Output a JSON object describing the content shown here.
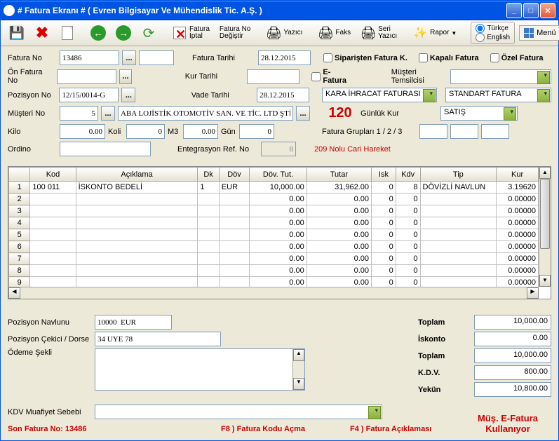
{
  "window": {
    "title": "# Fatura Ekranı #   ( Evren Bilgisayar Ve Mühendislik Tic. A.Ş. )"
  },
  "toolbar": {
    "fatura_iptal": "Fatura\nİptal",
    "fatura_no_degistir": "Fatura No\nDeğiştir",
    "yazici": "Yazıcı",
    "faks": "Faks",
    "seri_yazici": "Seri\nYazıcı",
    "rapor": "Rapor",
    "turkce": "Türkçe",
    "english": "English",
    "menu": "Menü"
  },
  "labels": {
    "fatura_no": "Fatura No",
    "on_fatura_no": "Ön Fatura No",
    "pozisyon_no": "Pozisyon No",
    "musteri_no": "Müşteri No",
    "kilo": "Kilo",
    "ordino": "Ordino",
    "koli": "Koli",
    "m3": "M3",
    "gun": "Gün",
    "fatura_tarihi": "Fatura Tarihi",
    "kur_tarihi": "Kur Tarihi",
    "vade_tarihi": "Vade Tarihi",
    "entegrasyon": "Entegrasyon Ref. No",
    "siparisten": "Siparişten Fatura K.",
    "efatura": "E-Fatura",
    "kapali": "Kapalı Fatura",
    "ozel": "Özel Fatura",
    "musteri_temsilcisi": "Müşteri Temsilcisi",
    "gunluk_kur": "Günlük Kur",
    "fatura_gruplari": "Fatura Grupları 1 / 2 / 3",
    "pozisyon_navlunu": "Pozisyon Navlunu",
    "pozisyon_cekici": "Pozisyon Çekici / Dorse",
    "odeme_sekli": "Ödeme Şekli",
    "kdv_muafiyet": "KDV Muafiyet Sebebi",
    "cari_hareket": "209 Nolu Cari Hareket"
  },
  "values": {
    "fatura_no": "13486",
    "on_fatura_no": "",
    "pozisyon_no": "12/15/0014-G",
    "musteri_no": "5",
    "musteri_adi": "ABA LOJİSTİK OTOMOTİV SAN. VE TİC. LTD ŞTİ",
    "kilo": "0.00",
    "koli": "0",
    "m3": "0.00",
    "gun": "0",
    "fatura_tarihi": "28.12.2015",
    "kur_tarihi": "",
    "vade_tarihi": "28.12.2015",
    "entegrasyon": "8",
    "fatura_tipi": "KARA İHRACAT FATURASI",
    "fatura_standart": "STANDART FATURA",
    "satis": "SATIŞ",
    "big_num": "120",
    "pozisyon_navlunu": "10000  EUR",
    "pozisyon_cekici": "34 UYE 78"
  },
  "grid": {
    "headers": [
      "",
      "Kod",
      "Açıklama",
      "Dk",
      "Döv",
      "Döv. Tut.",
      "Tutar",
      "Isk",
      "Kdv",
      "Tip",
      "Kur"
    ],
    "rows": [
      {
        "n": "1",
        "kod": "100 011",
        "acik": "İSKONTO BEDELİ",
        "dk": "1",
        "dov": "EUR",
        "dovtut": "10,000.00",
        "tutar": "31,962.00",
        "isk": "0",
        "kdv": "8",
        "tip": "DÖVİZLİ NAVLUN",
        "kur": "3.19620"
      },
      {
        "n": "2",
        "kod": "",
        "acik": "",
        "dk": "",
        "dov": "",
        "dovtut": "0.00",
        "tutar": "0.00",
        "isk": "0",
        "kdv": "0",
        "tip": "",
        "kur": "0.00000"
      },
      {
        "n": "3",
        "kod": "",
        "acik": "",
        "dk": "",
        "dov": "",
        "dovtut": "0.00",
        "tutar": "0.00",
        "isk": "0",
        "kdv": "0",
        "tip": "",
        "kur": "0.00000"
      },
      {
        "n": "4",
        "kod": "",
        "acik": "",
        "dk": "",
        "dov": "",
        "dovtut": "0.00",
        "tutar": "0.00",
        "isk": "0",
        "kdv": "0",
        "tip": "",
        "kur": "0.00000"
      },
      {
        "n": "5",
        "kod": "",
        "acik": "",
        "dk": "",
        "dov": "",
        "dovtut": "0.00",
        "tutar": "0.00",
        "isk": "0",
        "kdv": "0",
        "tip": "",
        "kur": "0.00000"
      },
      {
        "n": "6",
        "kod": "",
        "acik": "",
        "dk": "",
        "dov": "",
        "dovtut": "0.00",
        "tutar": "0.00",
        "isk": "0",
        "kdv": "0",
        "tip": "",
        "kur": "0.00000"
      },
      {
        "n": "7",
        "kod": "",
        "acik": "",
        "dk": "",
        "dov": "",
        "dovtut": "0.00",
        "tutar": "0.00",
        "isk": "0",
        "kdv": "0",
        "tip": "",
        "kur": "0.00000"
      },
      {
        "n": "8",
        "kod": "",
        "acik": "",
        "dk": "",
        "dov": "",
        "dovtut": "0.00",
        "tutar": "0.00",
        "isk": "0",
        "kdv": "0",
        "tip": "",
        "kur": "0.00000"
      },
      {
        "n": "9",
        "kod": "",
        "acik": "",
        "dk": "",
        "dov": "",
        "dovtut": "0.00",
        "tutar": "0.00",
        "isk": "0",
        "kdv": "0",
        "tip": "",
        "kur": "0.00000"
      }
    ]
  },
  "totals": {
    "toplam_lbl": "Toplam",
    "toplam": "10,000.00",
    "iskonto_lbl": "İskonto",
    "iskonto": "0.00",
    "toplam2_lbl": "Toplam",
    "toplam2": "10,000.00",
    "kdv_lbl": "K.D.V.",
    "kdv": "800.00",
    "yekun_lbl": "Yekün",
    "yekun": "10,800.00"
  },
  "footer": {
    "son_fatura": "Son Fatura No:   13486",
    "f8": "F8 ) Fatura Kodu Açma",
    "f4": "F4 ) Fatura Açıklaması",
    "efatura_msg": "Müş. E-Fatura\nKullanıyor"
  }
}
